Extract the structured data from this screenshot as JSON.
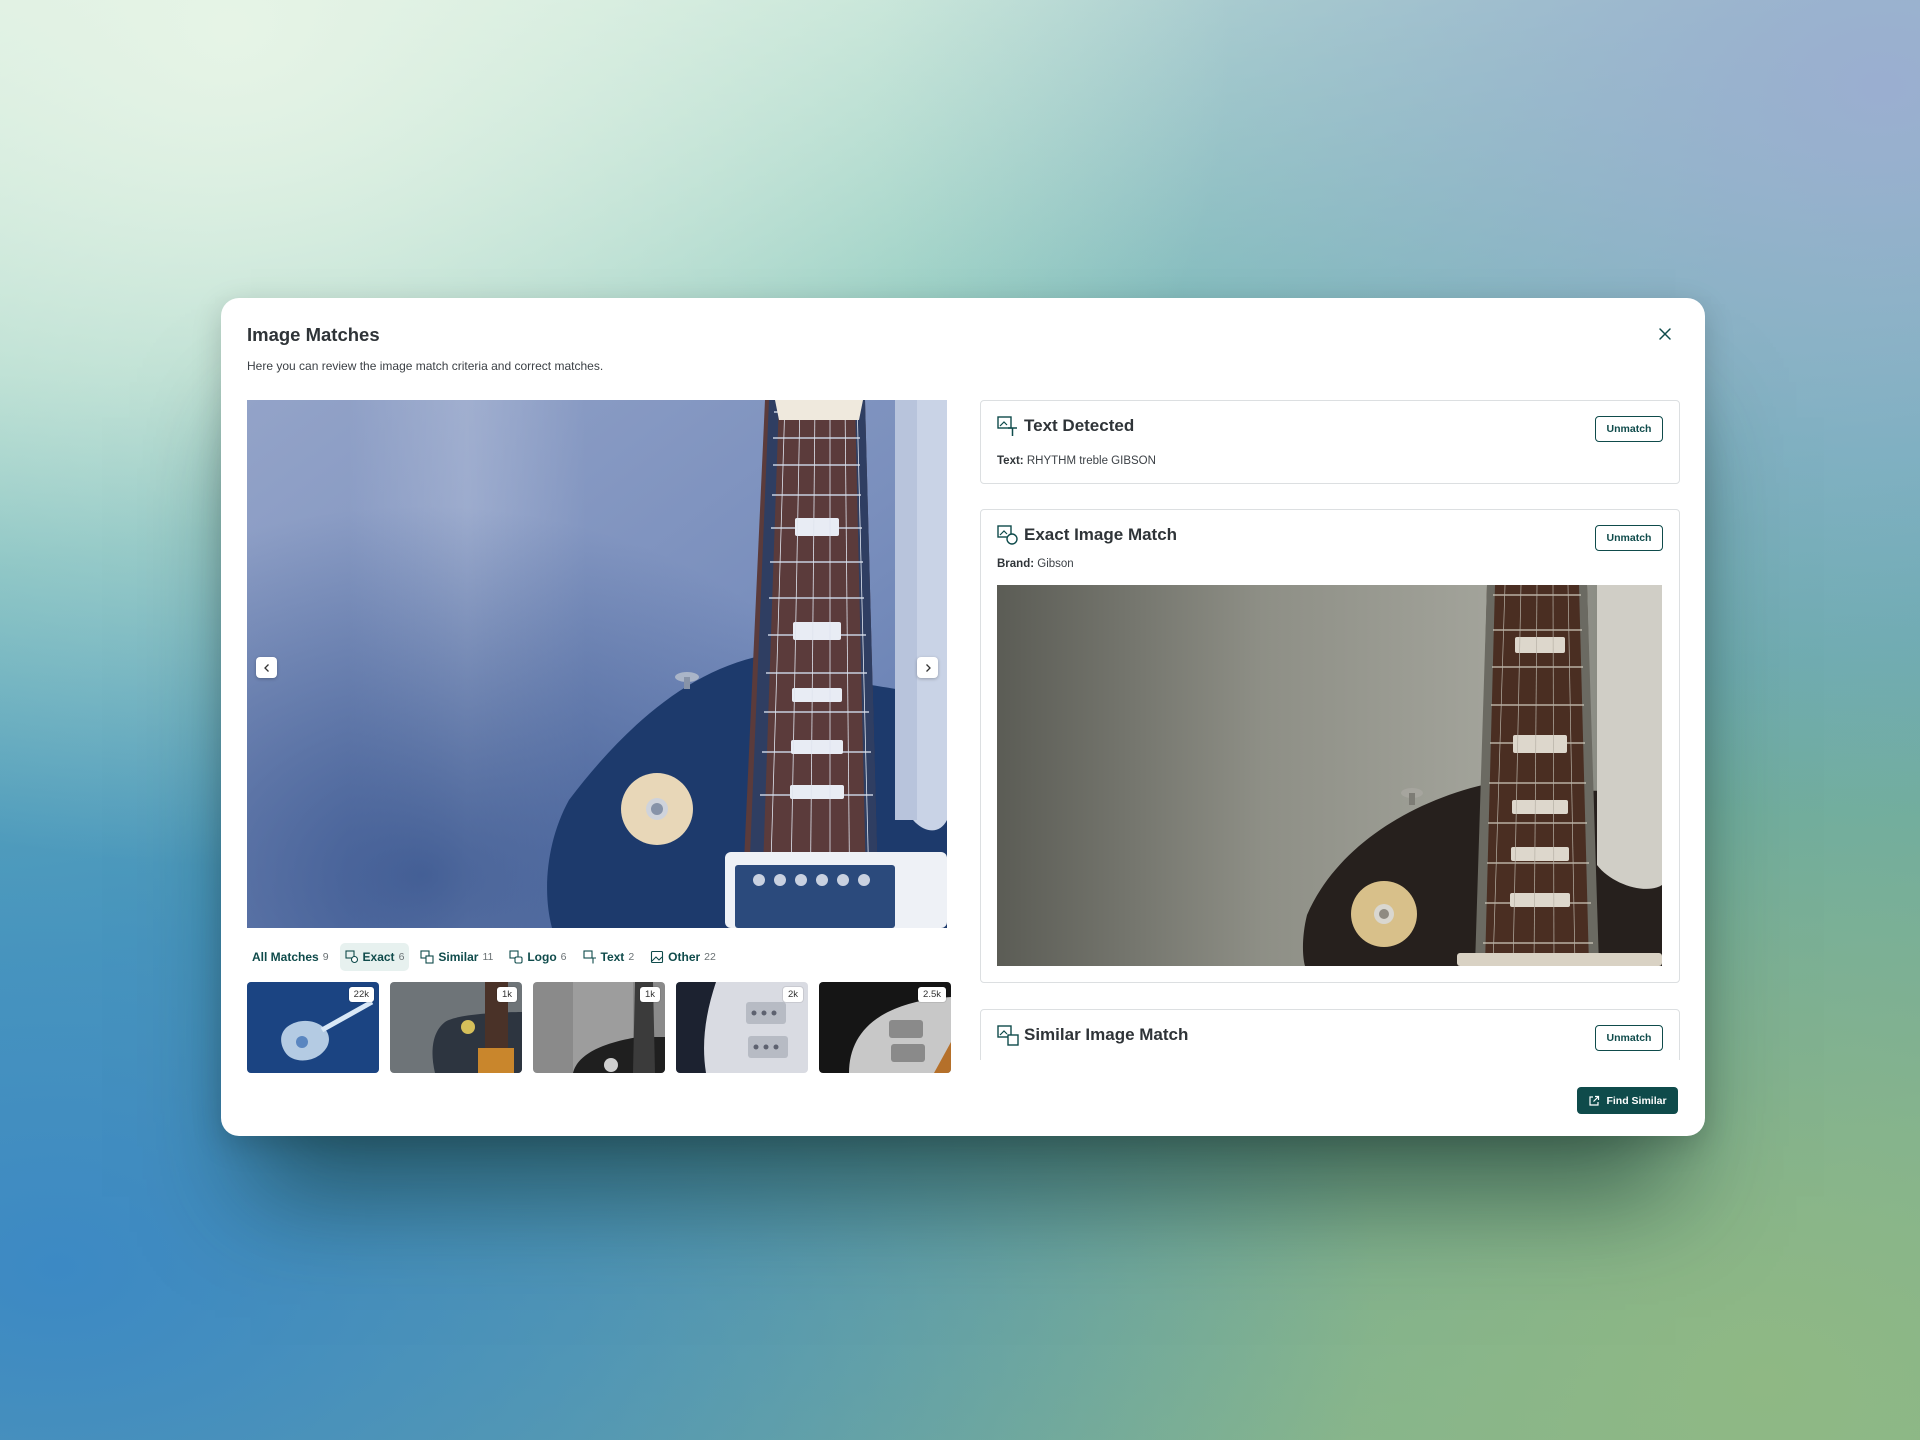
{
  "modal": {
    "title": "Image Matches",
    "subtitle": "Here you can review the image match criteria and correct matches."
  },
  "tabs": [
    {
      "label": "All Matches",
      "count": "9",
      "icon": "none",
      "active": false
    },
    {
      "label": "Exact",
      "count": "6",
      "icon": "exact-icon",
      "active": true
    },
    {
      "label": "Similar",
      "count": "11",
      "icon": "similar-icon",
      "active": false
    },
    {
      "label": "Logo",
      "count": "6",
      "icon": "logo-icon",
      "active": false
    },
    {
      "label": "Text",
      "count": "2",
      "icon": "text-icon",
      "active": false
    },
    {
      "label": "Other",
      "count": "22",
      "icon": "image-icon",
      "active": false
    }
  ],
  "thumbnails": [
    {
      "badge": "22k",
      "description": "blue guitar"
    },
    {
      "badge": "1k",
      "description": "guitar body close-up"
    },
    {
      "badge": "1k",
      "description": "grayscale guitar"
    },
    {
      "badge": "2k",
      "description": "guitar pickups"
    },
    {
      "badge": "2.5k",
      "description": "dark guitar"
    }
  ],
  "cards": {
    "text_detected": {
      "title": "Text Detected",
      "field_label": "Text:",
      "field_value": "RHYTHM treble GIBSON",
      "button": "Unmatch",
      "icon": "text-detect-icon"
    },
    "exact_match": {
      "title": "Exact Image Match",
      "field_label": "Brand:",
      "field_value": "Gibson",
      "button": "Unmatch",
      "icon": "exact-match-icon"
    },
    "similar_match": {
      "title": "Similar Image Match",
      "button": "Unmatch",
      "icon": "similar-match-icon"
    }
  },
  "actions": {
    "find_similar": "Find Similar",
    "find_similar_icon": "external-link-icon"
  },
  "colors": {
    "accent": "#0f4b4b",
    "tab_active_bg": "#e7f1ef",
    "border": "#dcdfe1"
  }
}
